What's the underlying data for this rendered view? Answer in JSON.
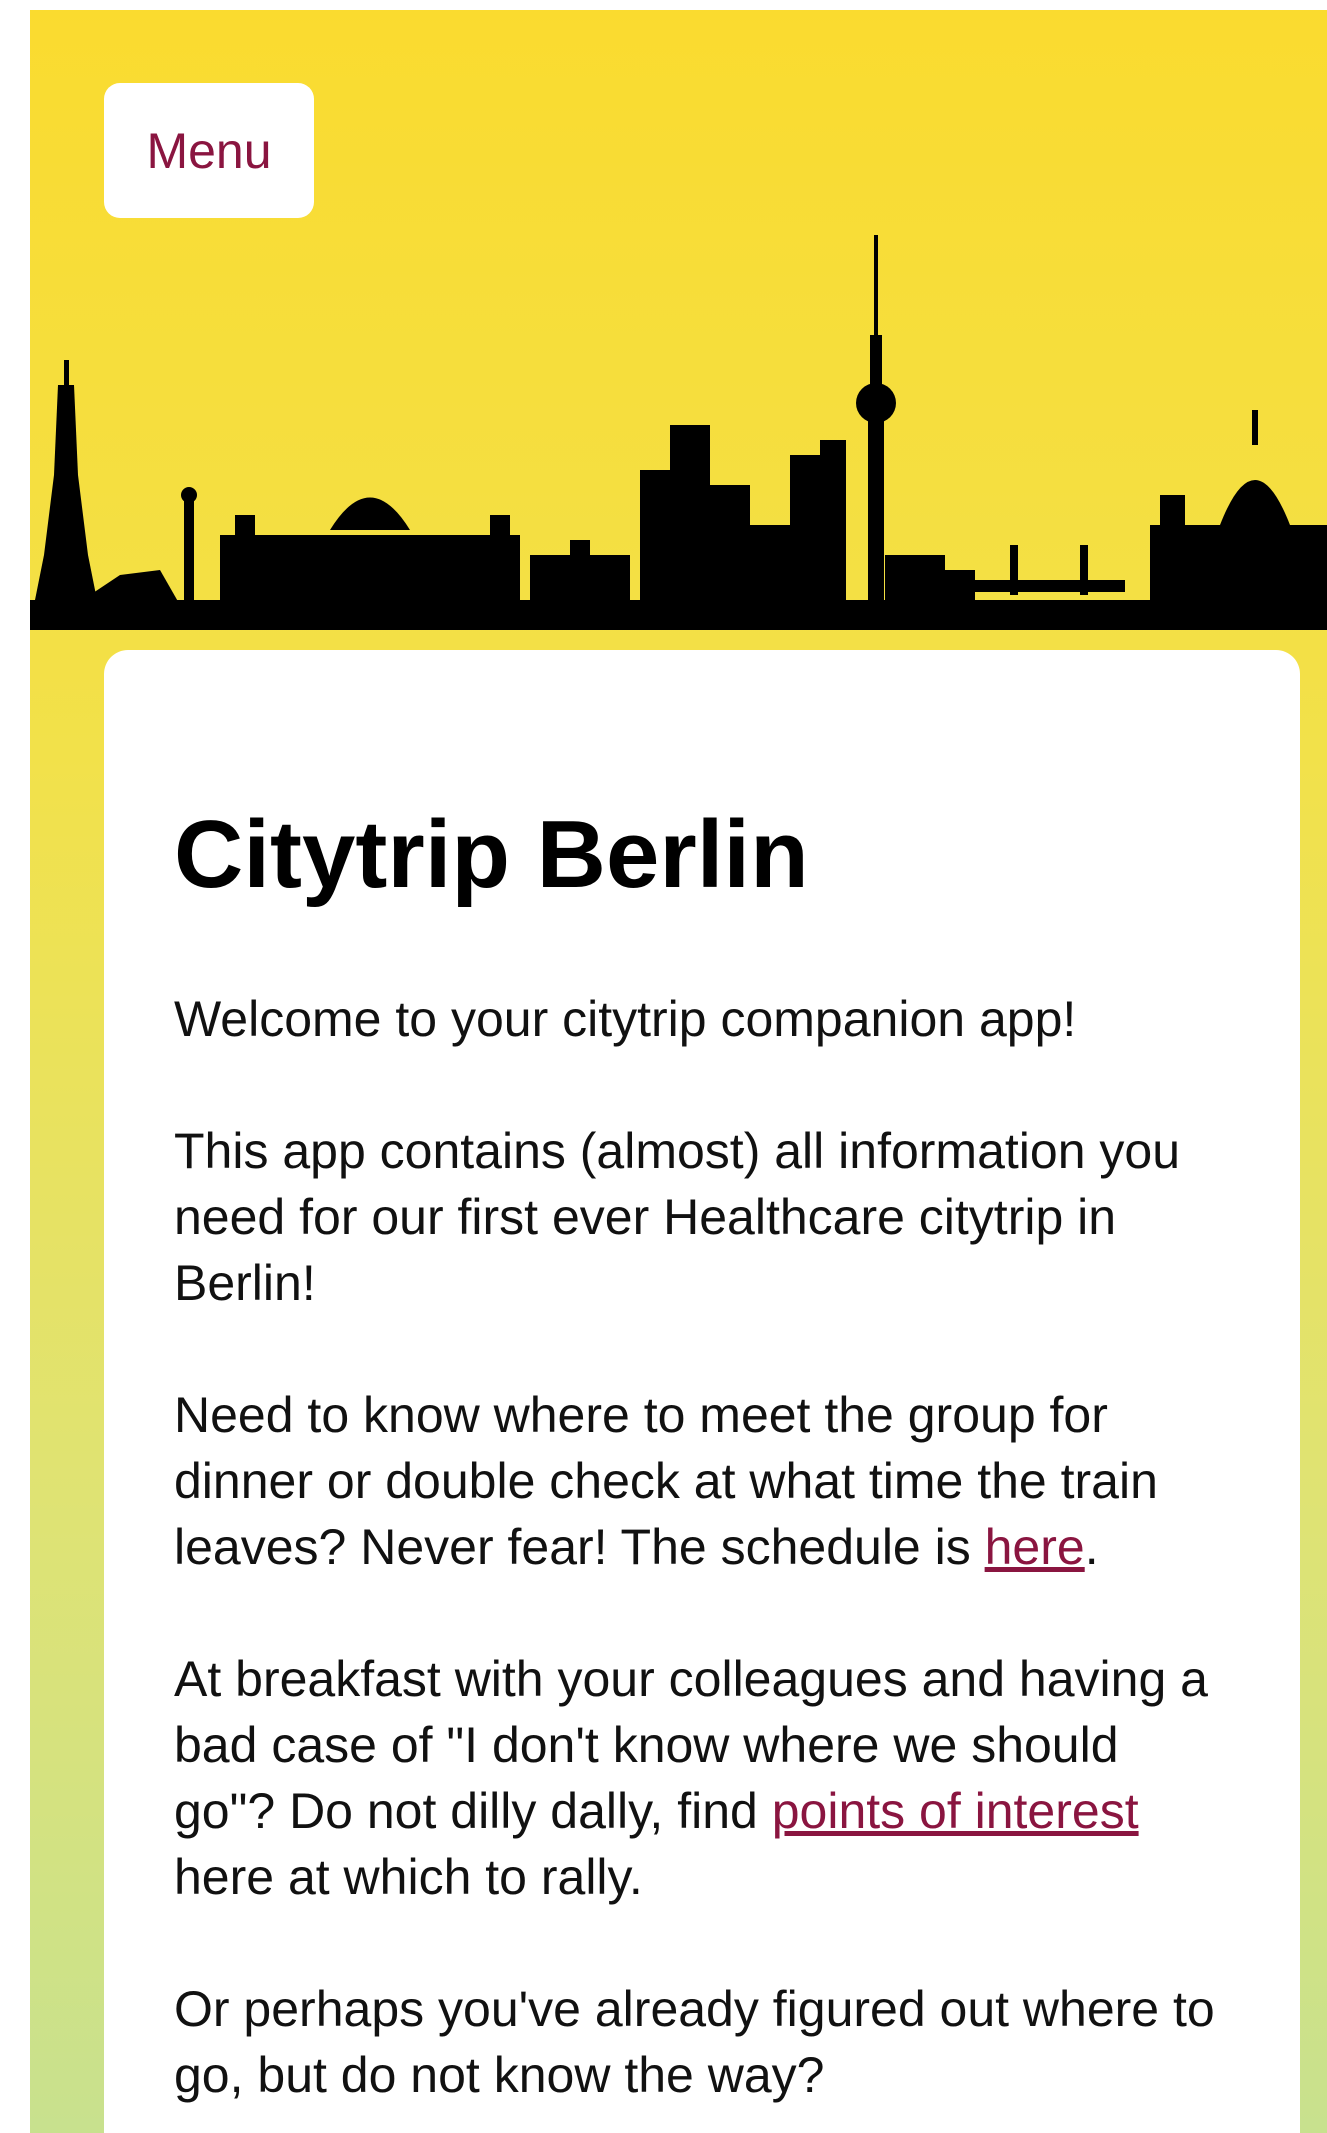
{
  "header": {
    "menu_label": "Menu"
  },
  "colors": {
    "accent": "#8a1540",
    "background_top": "#fadb2f",
    "background_bottom": "#c8e18e",
    "skyline": "#000000"
  },
  "main": {
    "title": "Citytrip Berlin",
    "welcome": "Welcome to your citytrip companion app!",
    "intro": "This app contains (almost) all information you need for our first ever Healthcare citytrip in Berlin!",
    "schedule_text": "Need to know where to meet the group for dinner or double check at what time the train leaves? Never fear! The schedule is ",
    "schedule_link": "here",
    "schedule_end": ".",
    "poi_text": "At breakfast with your colleagues and having a bad case of \"I don't know where we should go\"? Do not dilly dally, find ",
    "poi_link": "points of interest",
    "poi_end": " here at which to rally.",
    "directions_text": "Or perhaps you've already figured out where to go, but do not know the way?"
  }
}
